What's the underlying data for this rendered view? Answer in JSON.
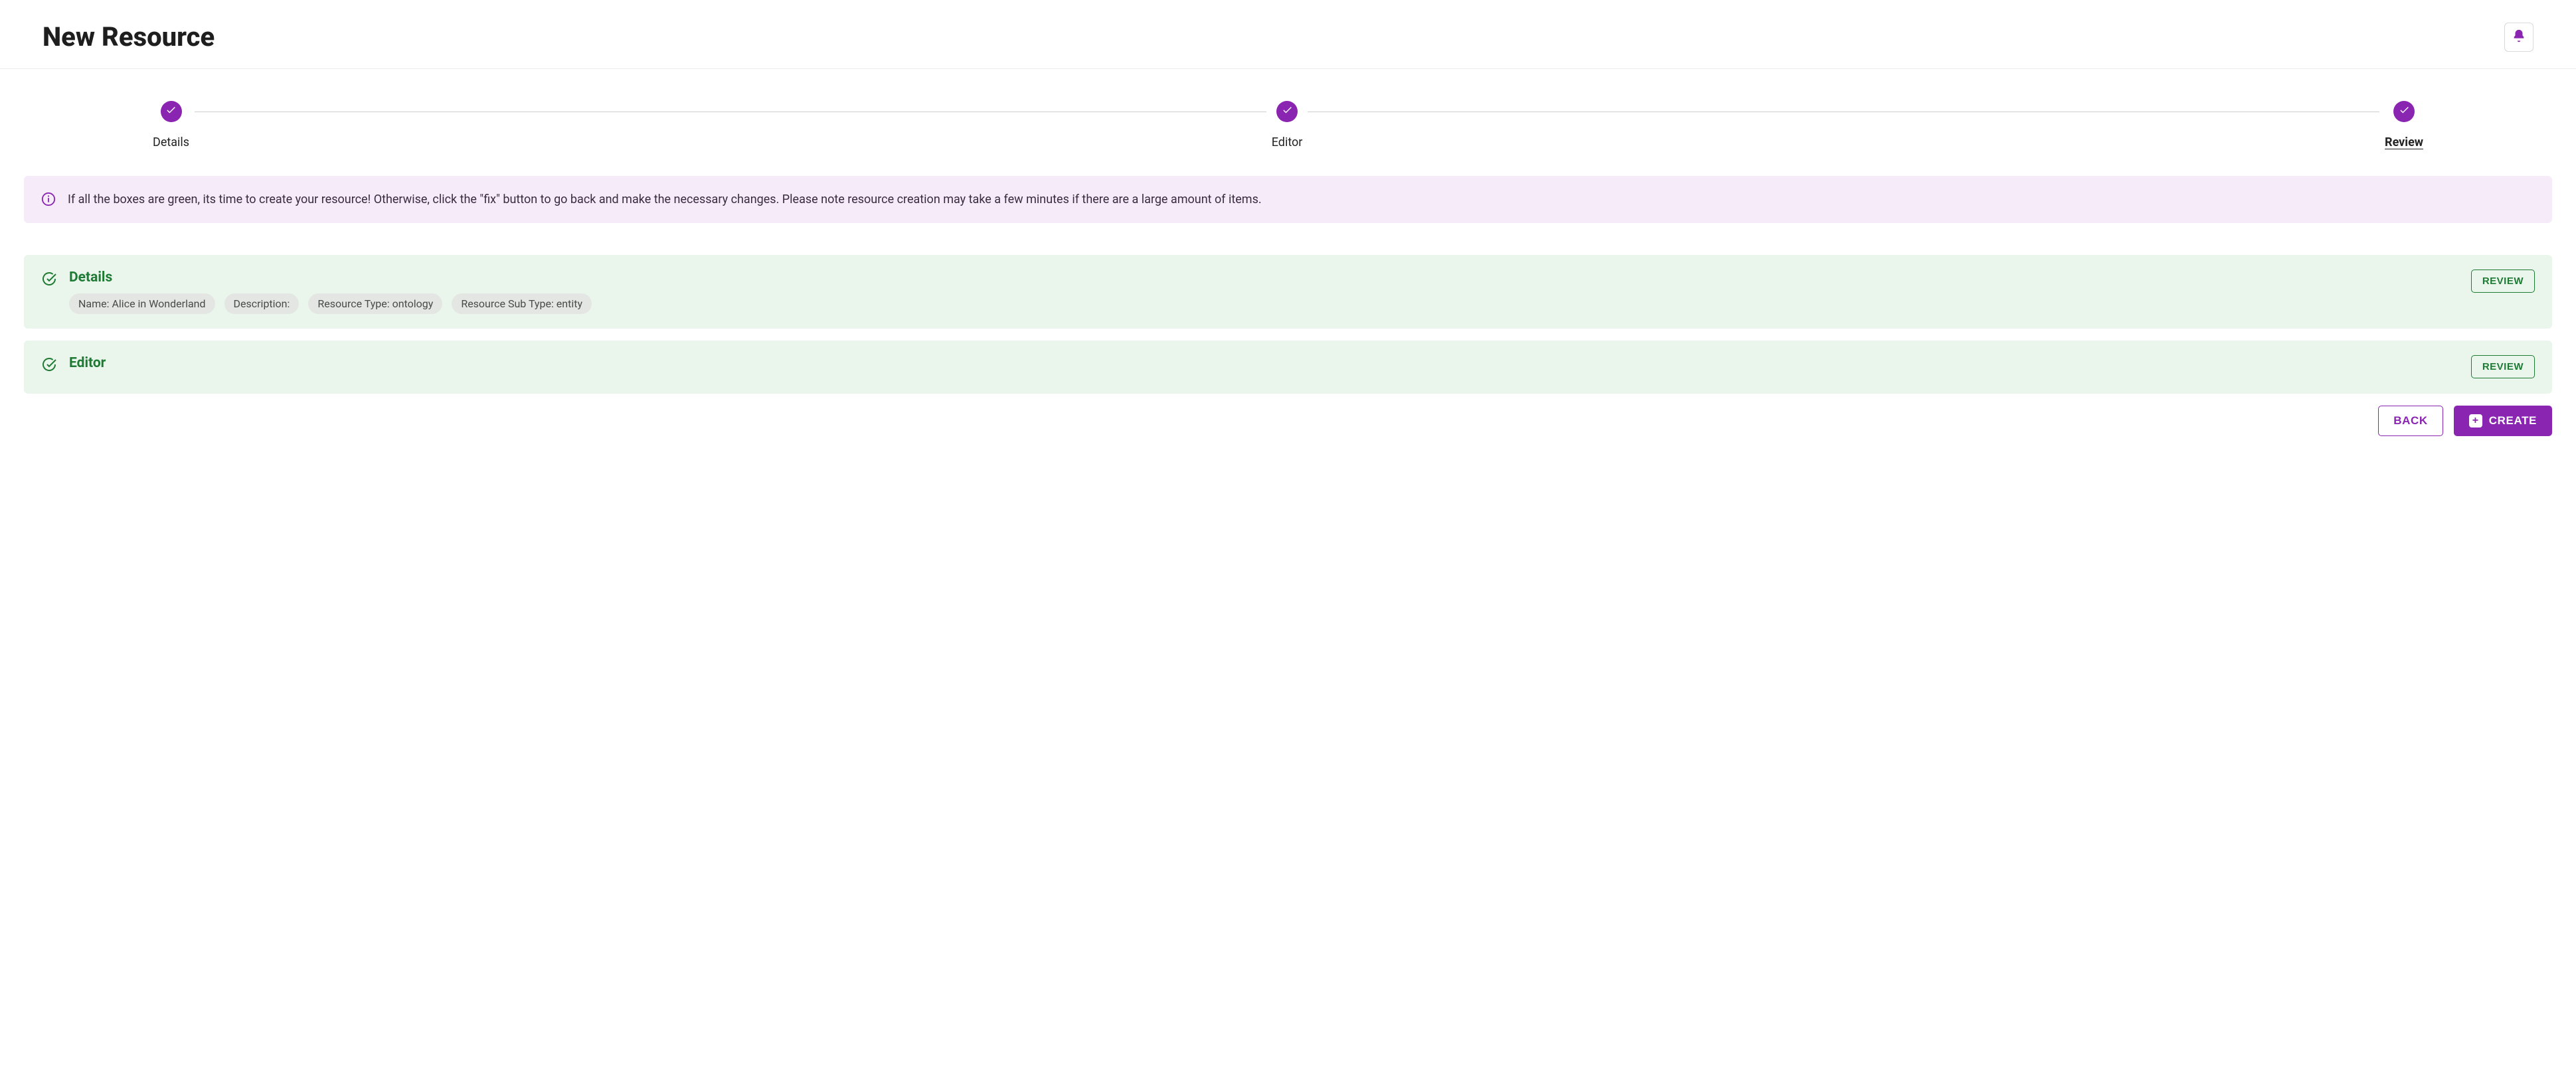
{
  "header": {
    "title": "New Resource"
  },
  "stepper": {
    "steps": [
      {
        "label": "Details",
        "complete": true,
        "active": false
      },
      {
        "label": "Editor",
        "complete": true,
        "active": false
      },
      {
        "label": "Review",
        "complete": true,
        "active": true
      }
    ]
  },
  "banner": {
    "text": "If all the boxes are green, its time to create your resource! Otherwise, click the \"fix\" button to go back and make the necessary changes. Please note resource creation may take a few minutes if there are a large amount of items."
  },
  "review": {
    "details": {
      "title": "Details",
      "chips": [
        "Name: Alice in Wonderland",
        "Description:",
        "Resource Type: ontology",
        "Resource Sub Type: entity"
      ],
      "review_label": "REVIEW"
    },
    "editor": {
      "title": "Editor",
      "review_label": "REVIEW"
    }
  },
  "actions": {
    "back_label": "BACK",
    "create_label": "CREATE"
  },
  "colors": {
    "accent": "#8a25b1",
    "success": "#1e7b34"
  }
}
